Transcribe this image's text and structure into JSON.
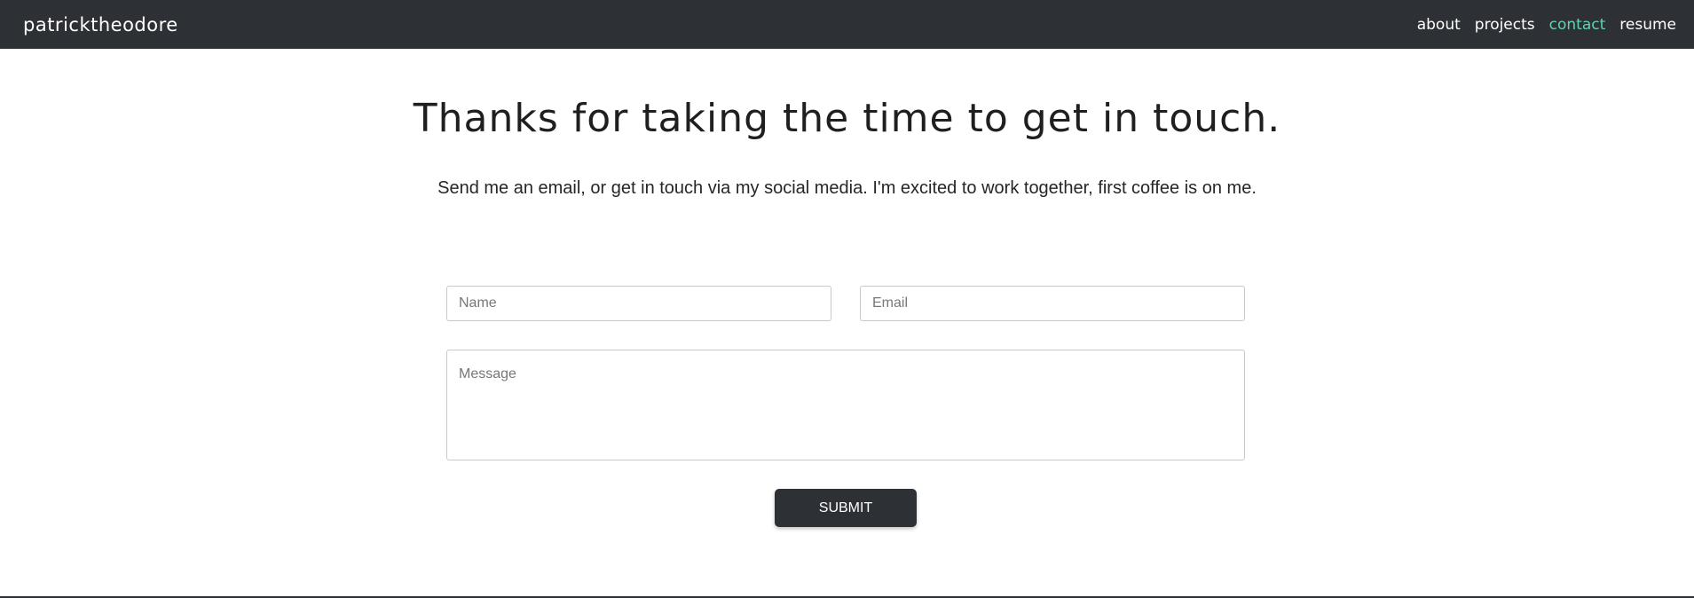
{
  "nav": {
    "brand": "patricktheodore",
    "links": [
      {
        "label": "about"
      },
      {
        "label": "projects"
      },
      {
        "label": "contact",
        "active": true
      },
      {
        "label": "resume"
      }
    ],
    "background": "#2d3035",
    "active_color": "#5fd3b3"
  },
  "main": {
    "heading": "Thanks for taking the time to get in touch.",
    "subheading": "Send me an email, or get in touch via my social media. I'm excited to work together, first coffee is on me."
  },
  "form": {
    "name_placeholder": "Name",
    "email_placeholder": "Email",
    "message_placeholder": "Message",
    "submit_label": "SUBMIT"
  }
}
